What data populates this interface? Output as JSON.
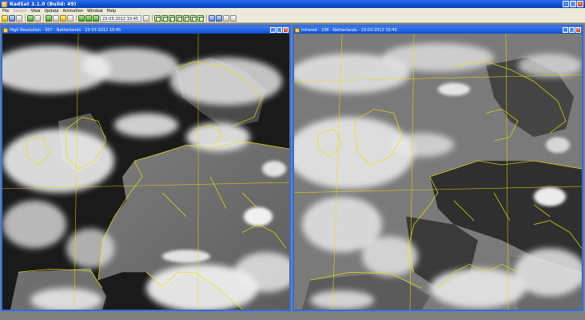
{
  "app": {
    "title": "RadSat 3.1.0 (Build: 49)"
  },
  "menu": {
    "items": [
      "File",
      "Search",
      "View",
      "Update",
      "Animation",
      "Window",
      "Help"
    ]
  },
  "toolbar": {
    "date_field": "23-03-2012 10:45"
  },
  "windows": [
    {
      "title": "High Resolution - 007 - Netherlands - 23-03-2012 10:45"
    },
    {
      "title": "Infrared - 108 - Netherlands - 23-03-2012 10:45"
    }
  ],
  "colors": {
    "title_blue": "#0b4fd6",
    "overlay": "#e5e200",
    "close_red": "#d8481f"
  }
}
